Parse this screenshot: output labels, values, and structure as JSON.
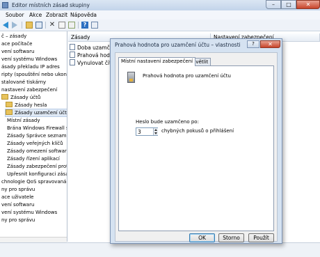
{
  "window": {
    "title": "Editor místních zásad skupiny",
    "minimize": "–",
    "maximize": "□",
    "close": "✕"
  },
  "menu": [
    "Soubor",
    "Akce",
    "Zobrazit",
    "Nápověda"
  ],
  "toolbar": {
    "help": "?"
  },
  "tree": [
    "č – zásady",
    "ace počítače",
    "vení softwaru",
    "vení systému Windows",
    "ásady překladu IP adres",
    "ripty (spouštění nebo ukonč",
    "stalované tiskárny",
    "nastavení zabezpečení",
    "Zásady účtů",
    "Zásady hesla",
    "Zásady uzamčení účtů",
    "Místní zásady",
    "Brána Windows Firewall s p",
    "Zásady Správce seznamu sít",
    "Zásady veřejných klíčů",
    "Zásady omezení softwaru",
    "Zásady řízení aplikací",
    "Zásady zabezpečení protoko",
    "Upřesnit konfiguraci zásad a",
    "chnologie QoS spravovaná p",
    "ny pro správu",
    "ace uživatele",
    "vení softwaru",
    "vení systému Windows",
    "ny pro správu"
  ],
  "list": {
    "col_policy": "Zásady",
    "col_setting": "Nastavení zabezpečení",
    "items": [
      "Doba uzamčen",
      "Prahová hodno",
      "Vynulovat čítač"
    ]
  },
  "dialog": {
    "title": "Prahová hodnota pro uzamčení účtu – vlastnosti",
    "help": "?",
    "close": "✕",
    "tab_local": "Místní nastavení zabezpečení",
    "tab_explain": "Vysvětlit",
    "policy_name": "Prahová hodnota pro uzamčení účtu",
    "field_label": "Heslo bude uzamčeno po:",
    "field_value": "3",
    "field_suffix": "chybných pokusů o přihlášení",
    "ok": "OK",
    "cancel": "Storno",
    "apply": "Použít"
  }
}
